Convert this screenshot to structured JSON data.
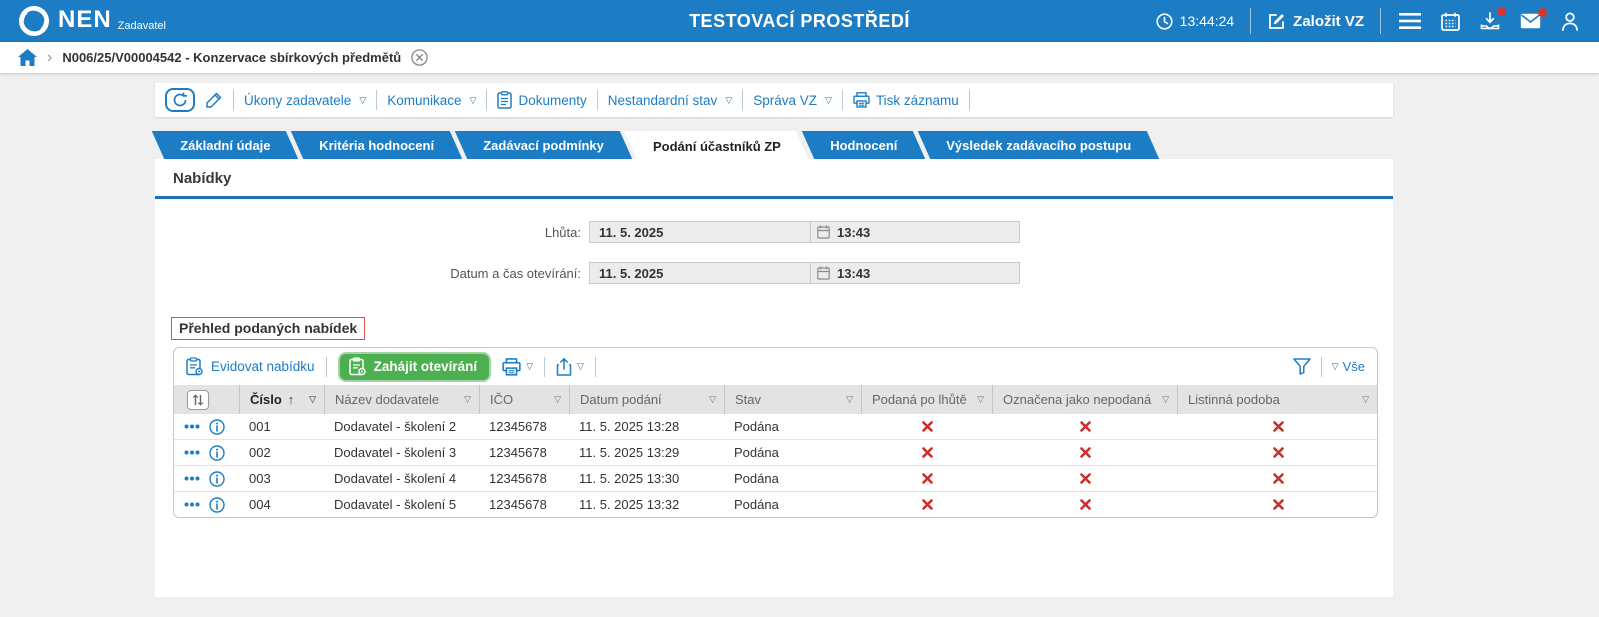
{
  "app": {
    "brand": "NEN",
    "brand_subtitle": "Zadavatel",
    "environment_title": "TESTOVACÍ PROSTŘEDÍ",
    "clock": "13:44:24",
    "create_vz_label": "Založit VZ"
  },
  "breadcrumb": {
    "current": "N006/25/V00004542 - Konzervace sbírkových předmětů"
  },
  "record_toolbar": {
    "ukony_zadavatele": "Úkony zadavatele",
    "komunikace": "Komunikace",
    "dokumenty": "Dokumenty",
    "nestandardni_stav": "Nestandardní stav",
    "sprava_vz": "Správa VZ",
    "tisk_zaznamu": "Tisk záznamu"
  },
  "tabs": [
    {
      "label": "Základní údaje",
      "active": false
    },
    {
      "label": "Kritéria hodnocení",
      "active": false
    },
    {
      "label": "Zadávací podmínky",
      "active": false
    },
    {
      "label": "Podání účastníků ZP",
      "active": true
    },
    {
      "label": "Hodnocení",
      "active": false
    },
    {
      "label": "Výsledek zadávacího postupu",
      "active": false
    }
  ],
  "section": {
    "title": "Nabídky"
  },
  "deadline_form": {
    "rows": [
      {
        "label": "Lhůta:",
        "date": "11. 5. 2025",
        "time": "13:43"
      },
      {
        "label": "Datum a čas otevírání:",
        "date": "11. 5. 2025",
        "time": "13:43"
      }
    ]
  },
  "offers": {
    "title": "Přehled podaných nabídek",
    "register_button": "Evidovat nabídku",
    "start_opening_button": "Zahájit otevírání",
    "filter_all_label": "Vše",
    "columns": [
      "Číslo",
      "Název dodavatele",
      "IČO",
      "Datum podání",
      "Stav",
      "Podaná po lhůtě",
      "Označena jako nepodaná",
      "Listinná podoba"
    ],
    "sorted_column": "Číslo",
    "sort_direction": "asc",
    "rows": [
      {
        "number": "001",
        "supplier": "Dodavatel - školení 2",
        "ico": "12345678",
        "submitted": "11. 5. 2025 13:28",
        "status": "Podána",
        "late": false,
        "marked_not_submitted": false,
        "paper_form": false
      },
      {
        "number": "002",
        "supplier": "Dodavatel - školení 3",
        "ico": "12345678",
        "submitted": "11. 5. 2025 13:29",
        "status": "Podána",
        "late": false,
        "marked_not_submitted": false,
        "paper_form": false
      },
      {
        "number": "003",
        "supplier": "Dodavatel - školení 4",
        "ico": "12345678",
        "submitted": "11. 5. 2025 13:30",
        "status": "Podána",
        "late": false,
        "marked_not_submitted": false,
        "paper_form": false
      },
      {
        "number": "004",
        "supplier": "Dodavatel - školení 5",
        "ico": "12345678",
        "submitted": "11. 5. 2025 13:32",
        "status": "Podána",
        "late": false,
        "marked_not_submitted": false,
        "paper_form": false
      }
    ]
  },
  "colors": {
    "header_blue": "#1d7dc4",
    "tab_underline_blue": "#1a6fb5",
    "action_green": "#4caf50",
    "cross_red": "#c9302c",
    "title_border_red": "#d9534f",
    "notification_red": "#d6352b"
  }
}
